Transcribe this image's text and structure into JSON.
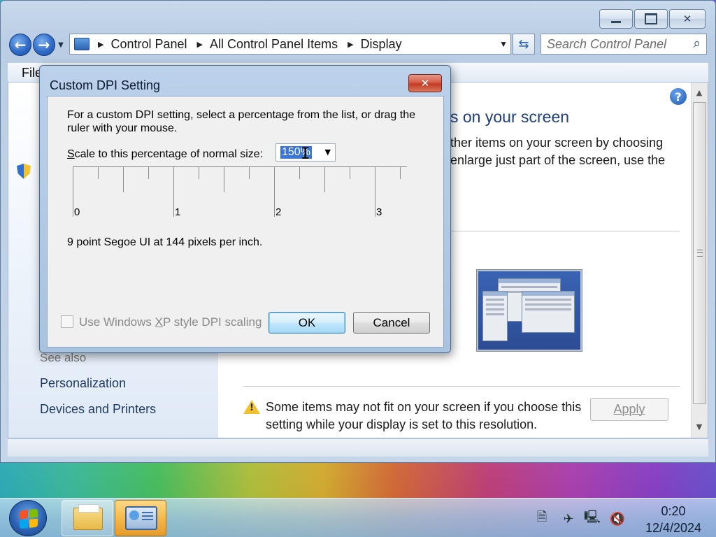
{
  "window": {
    "breadcrumbs": [
      "Control Panel",
      "All Control Panel Items",
      "Display"
    ],
    "search_placeholder": "Search Control Panel",
    "menu_file": "File"
  },
  "left_pane": {
    "see_also": "See also",
    "links": [
      "Personalization",
      "Devices and Printers"
    ]
  },
  "main": {
    "heading": "s on your screen",
    "description": "ther items on your screen by choosing enlarge just part of the screen, use the",
    "warning": "Some items may not fit on your screen if you choose this setting while your display is set to this resolution.",
    "apply_label": "Apply"
  },
  "dialog": {
    "title": "Custom DPI Setting",
    "instructions": "For a custom DPI setting, select a percentage from the list, or drag the ruler with your mouse.",
    "scale_label_prefix": "S",
    "scale_label_rest": "cale to this percentage of normal size:",
    "scale_value": "150%",
    "ruler_numbers": [
      "0",
      "1",
      "2",
      "3"
    ],
    "dpi_info": "9 point Segoe UI at 144 pixels per inch.",
    "xp_label_pre": "Use Windows ",
    "xp_label_key": "X",
    "xp_label_post": "P style DPI scaling",
    "xp_checked": false,
    "ok_label": "OK",
    "cancel_label": "Cancel"
  },
  "taskbar": {
    "time": "0:20",
    "date": "12/4/2024"
  }
}
